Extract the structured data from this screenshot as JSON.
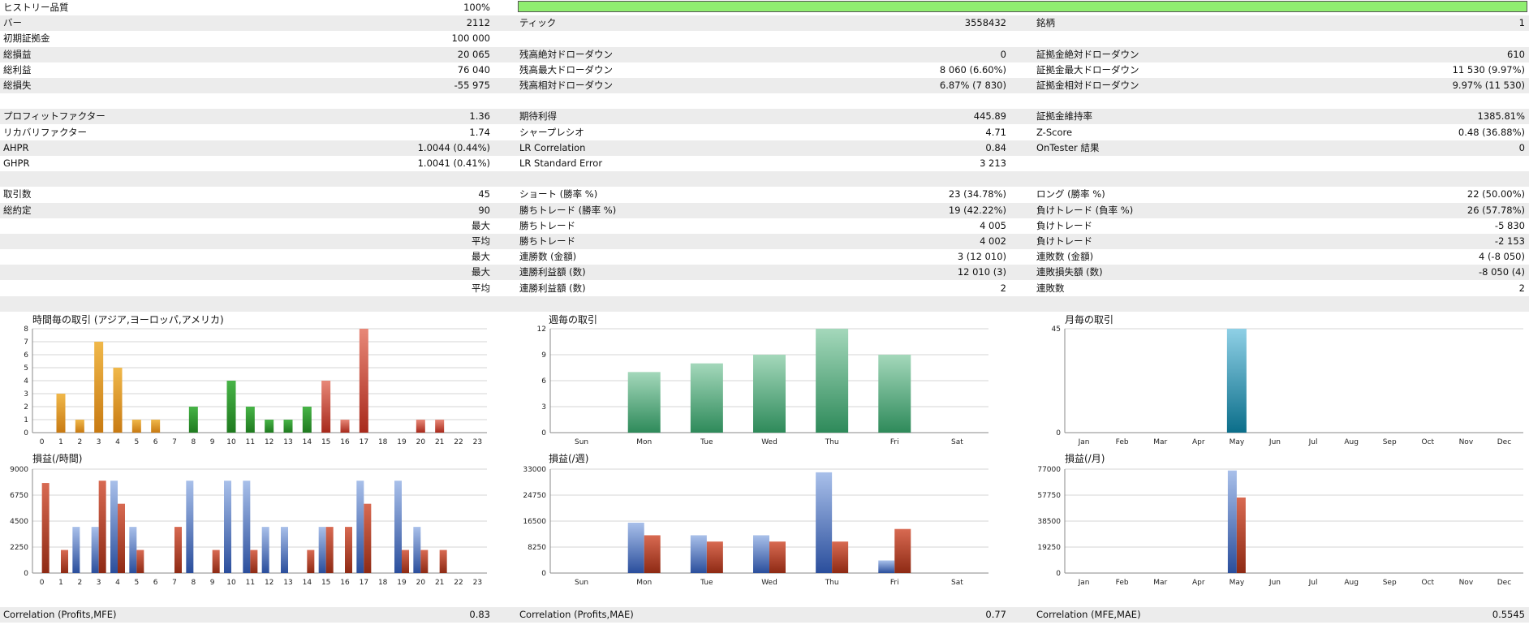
{
  "colors": {
    "orange": "#e8a033",
    "green": "#2e9a2e",
    "red": "#b83a2a",
    "weekly_green": "#4aa877",
    "monthly_teal": "#2a9bb5",
    "blue_profit": "#4b74c4",
    "red_loss": "#c44a36",
    "quality_bar": "#90ee70"
  },
  "rows": [
    {
      "l1": "ヒストリー品質",
      "v1": "100%",
      "l2": "",
      "v2": "",
      "l3": "",
      "v3": "",
      "bar": true,
      "alt": false
    },
    {
      "l1": "バー",
      "v1": "2112",
      "l2": "ティック",
      "v2": "3558432",
      "l3": "銘柄",
      "v3": "1",
      "alt": true
    },
    {
      "l1": "初期証拠金",
      "v1": "100 000",
      "l2": "",
      "v2": "",
      "l3": "",
      "v3": "",
      "alt": false
    },
    {
      "l1": "総損益",
      "v1": "20 065",
      "l2": "残高絶対ドローダウン",
      "v2": "0",
      "l3": "証拠金絶対ドローダウン",
      "v3": "610",
      "alt": true
    },
    {
      "l1": "総利益",
      "v1": "76 040",
      "l2": "残高最大ドローダウン",
      "v2": "8 060 (6.60%)",
      "l3": "証拠金最大ドローダウン",
      "v3": "11 530 (9.97%)",
      "alt": false
    },
    {
      "l1": "総損失",
      "v1": "-55 975",
      "l2": "残高相対ドローダウン",
      "v2": "6.87% (7 830)",
      "l3": "証拠金相対ドローダウン",
      "v3": "9.97% (11 530)",
      "alt": true
    },
    {
      "l1": "",
      "v1": "",
      "l2": "",
      "v2": "",
      "l3": "",
      "v3": "",
      "alt": false
    },
    {
      "l1": "プロフィットファクター",
      "v1": "1.36",
      "l2": "期待利得",
      "v2": "445.89",
      "l3": "証拠金維持率",
      "v3": "1385.81%",
      "alt": true
    },
    {
      "l1": "リカバリファクター",
      "v1": "1.74",
      "l2": "シャープレシオ",
      "v2": "4.71",
      "l3": "Z-Score",
      "v3": "0.48 (36.88%)",
      "alt": false
    },
    {
      "l1": "AHPR",
      "v1": "1.0044 (0.44%)",
      "l2": "LR Correlation",
      "v2": "0.84",
      "l3": "OnTester 結果",
      "v3": "0",
      "alt": true
    },
    {
      "l1": "GHPR",
      "v1": "1.0041 (0.41%)",
      "l2": "LR Standard Error",
      "v2": "3 213",
      "l3": "",
      "v3": "",
      "alt": false
    },
    {
      "l1": "",
      "v1": "",
      "l2": "",
      "v2": "",
      "l3": "",
      "v3": "",
      "alt": true
    },
    {
      "l1": "取引数",
      "v1": "45",
      "l2": "ショート (勝率 %)",
      "v2": "23 (34.78%)",
      "l3": "ロング (勝率 %)",
      "v3": "22 (50.00%)",
      "alt": false
    },
    {
      "l1": "総約定",
      "v1": "90",
      "l2": "勝ちトレード (勝率 %)",
      "v2": "19 (42.22%)",
      "l3": "負けトレード (負率 %)",
      "v3": "26 (57.78%)",
      "alt": true
    },
    {
      "l1": "",
      "v1": "最大",
      "l2": "勝ちトレード",
      "v2": "4 005",
      "l3": "負けトレード",
      "v3": "-5 830",
      "alt": false
    },
    {
      "l1": "",
      "v1": "平均",
      "l2": "勝ちトレード",
      "v2": "4 002",
      "l3": "負けトレード",
      "v3": "-2 153",
      "alt": true
    },
    {
      "l1": "",
      "v1": "最大",
      "l2": "連勝数 (金額)",
      "v2": "3 (12 010)",
      "l3": "連敗数 (金額)",
      "v3": "4 (-8 050)",
      "alt": false
    },
    {
      "l1": "",
      "v1": "最大",
      "l2": "連勝利益額 (数)",
      "v2": "12 010 (3)",
      "l3": "連敗損失額 (数)",
      "v3": "-8 050 (4)",
      "alt": true
    },
    {
      "l1": "",
      "v1": "平均",
      "l2": "連勝利益額 (数)",
      "v2": "2",
      "l3": "連敗数",
      "v3": "2",
      "alt": false
    },
    {
      "l1": "",
      "v1": "",
      "l2": "",
      "v2": "",
      "l3": "",
      "v3": "",
      "alt": true
    }
  ],
  "footer": {
    "l1": "Correlation (Profits,MFE)",
    "v1": "0.83",
    "l2": "Correlation (Profits,MAE)",
    "v2": "0.77",
    "l3": "Correlation (MFE,MAE)",
    "v3": "0.5545"
  },
  "chart_data": [
    {
      "type": "bar",
      "title": "時間毎の取引 (アジア,ヨーロッパ,アメリカ)",
      "categories": [
        "0",
        "1",
        "2",
        "3",
        "4",
        "5",
        "6",
        "7",
        "8",
        "9",
        "10",
        "11",
        "12",
        "13",
        "14",
        "15",
        "16",
        "17",
        "18",
        "19",
        "20",
        "21",
        "22",
        "23"
      ],
      "values": [
        0,
        3,
        1,
        7,
        5,
        1,
        1,
        0,
        2,
        0,
        4,
        2,
        1,
        1,
        2,
        4,
        1,
        8,
        0,
        0,
        1,
        1,
        0,
        0
      ],
      "yticks": [
        0,
        1,
        2,
        3,
        4,
        5,
        6,
        7,
        8
      ],
      "ylim": [
        0,
        8
      ]
    },
    {
      "type": "bar",
      "title": "週毎の取引",
      "categories": [
        "Sun",
        "Mon",
        "Tue",
        "Wed",
        "Thu",
        "Fri",
        "Sat"
      ],
      "values": [
        0,
        7,
        8,
        9,
        12,
        9,
        0
      ],
      "yticks": [
        0,
        3,
        6,
        9,
        12
      ],
      "ylim": [
        0,
        12
      ]
    },
    {
      "type": "bar",
      "title": "月毎の取引",
      "categories": [
        "Jan",
        "Feb",
        "Mar",
        "Apr",
        "May",
        "Jun",
        "Jul",
        "Aug",
        "Sep",
        "Oct",
        "Nov",
        "Dec"
      ],
      "values": [
        0,
        0,
        0,
        0,
        45,
        0,
        0,
        0,
        0,
        0,
        0,
        0
      ],
      "yticks": [
        0,
        45
      ],
      "ylim": [
        0,
        45
      ]
    },
    {
      "type": "bar",
      "title": "損益(/時間)",
      "categories": [
        "0",
        "1",
        "2",
        "3",
        "4",
        "5",
        "6",
        "7",
        "8",
        "9",
        "10",
        "11",
        "12",
        "13",
        "14",
        "15",
        "16",
        "17",
        "18",
        "19",
        "20",
        "21",
        "22",
        "23"
      ],
      "series": [
        {
          "values": [
            0,
            0,
            4000,
            4000,
            8000,
            4000,
            0,
            0,
            8000,
            0,
            8000,
            8000,
            4000,
            4000,
            0,
            4000,
            0,
            8000,
            0,
            8000,
            4000,
            0,
            0,
            0
          ]
        },
        {
          "values": [
            7800,
            2000,
            0,
            8000,
            6000,
            2000,
            0,
            4000,
            0,
            2000,
            0,
            2000,
            0,
            0,
            2000,
            4000,
            4000,
            6000,
            0,
            2000,
            2000,
            2000,
            0,
            0
          ]
        }
      ],
      "yticks": [
        0,
        2250,
        4500,
        6750,
        9000
      ],
      "ylim": [
        0,
        9000
      ]
    },
    {
      "type": "bar",
      "title": "損益(/週)",
      "categories": [
        "Sun",
        "Mon",
        "Tue",
        "Wed",
        "Thu",
        "Fri",
        "Sat"
      ],
      "series": [
        {
          "values": [
            0,
            16000,
            12000,
            12000,
            32000,
            4000,
            0
          ]
        },
        {
          "values": [
            0,
            12000,
            10000,
            10000,
            10000,
            14000,
            0
          ]
        }
      ],
      "yticks": [
        0,
        8250,
        16500,
        24750,
        33000
      ],
      "ylim": [
        0,
        33000
      ]
    },
    {
      "type": "bar",
      "title": "損益(/月)",
      "categories": [
        "Jan",
        "Feb",
        "Mar",
        "Apr",
        "May",
        "Jun",
        "Jul",
        "Aug",
        "Sep",
        "Oct",
        "Nov",
        "Dec"
      ],
      "series": [
        {
          "values": [
            0,
            0,
            0,
            0,
            76000,
            0,
            0,
            0,
            0,
            0,
            0,
            0
          ]
        },
        {
          "values": [
            0,
            0,
            0,
            0,
            56000,
            0,
            0,
            0,
            0,
            0,
            0,
            0
          ]
        }
      ],
      "yticks": [
        0,
        19250,
        38500,
        57750,
        77000
      ],
      "ylim": [
        0,
        77000
      ]
    }
  ]
}
